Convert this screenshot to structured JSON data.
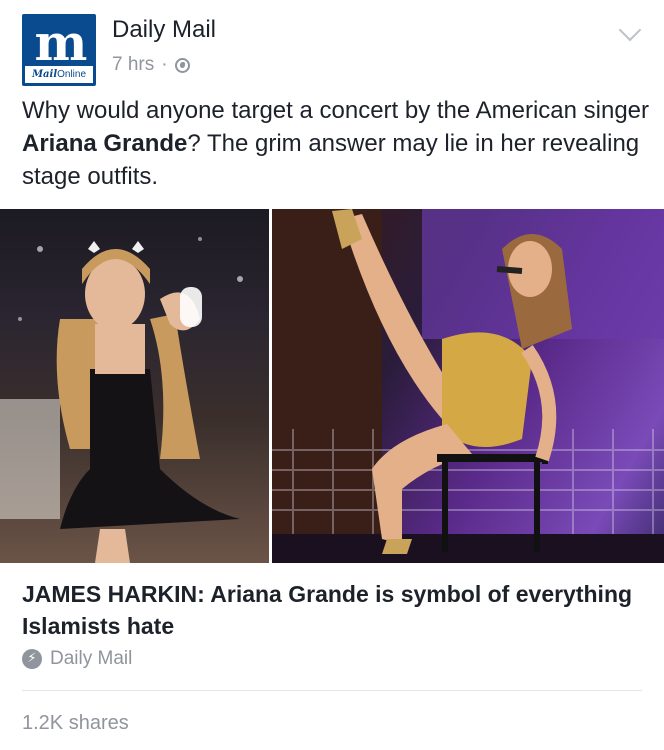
{
  "post": {
    "page_name": "Daily Mail",
    "logo_letter": "m",
    "logo_strip_bold": "Mail",
    "logo_strip_rest": "Online",
    "time": "7 hrs",
    "separator": "·",
    "text_before": "Why would anyone target a concert by the American singer ",
    "text_bold": "Ariana Grande",
    "text_after": "? The grim answer may lie in her revealing stage outfits."
  },
  "link": {
    "headline": "JAMES HARKIN: Ariana Grande is symbol of everything Islamists hate",
    "source": "Daily Mail"
  },
  "footer": {
    "shares": "1.2K shares"
  },
  "icons": {
    "menu": "chevron-down-icon",
    "privacy": "globe-icon",
    "source": "instant-article-bolt-icon"
  },
  "colors": {
    "logo_blue": "#0a4a8f",
    "meta_gray": "#90949c"
  }
}
